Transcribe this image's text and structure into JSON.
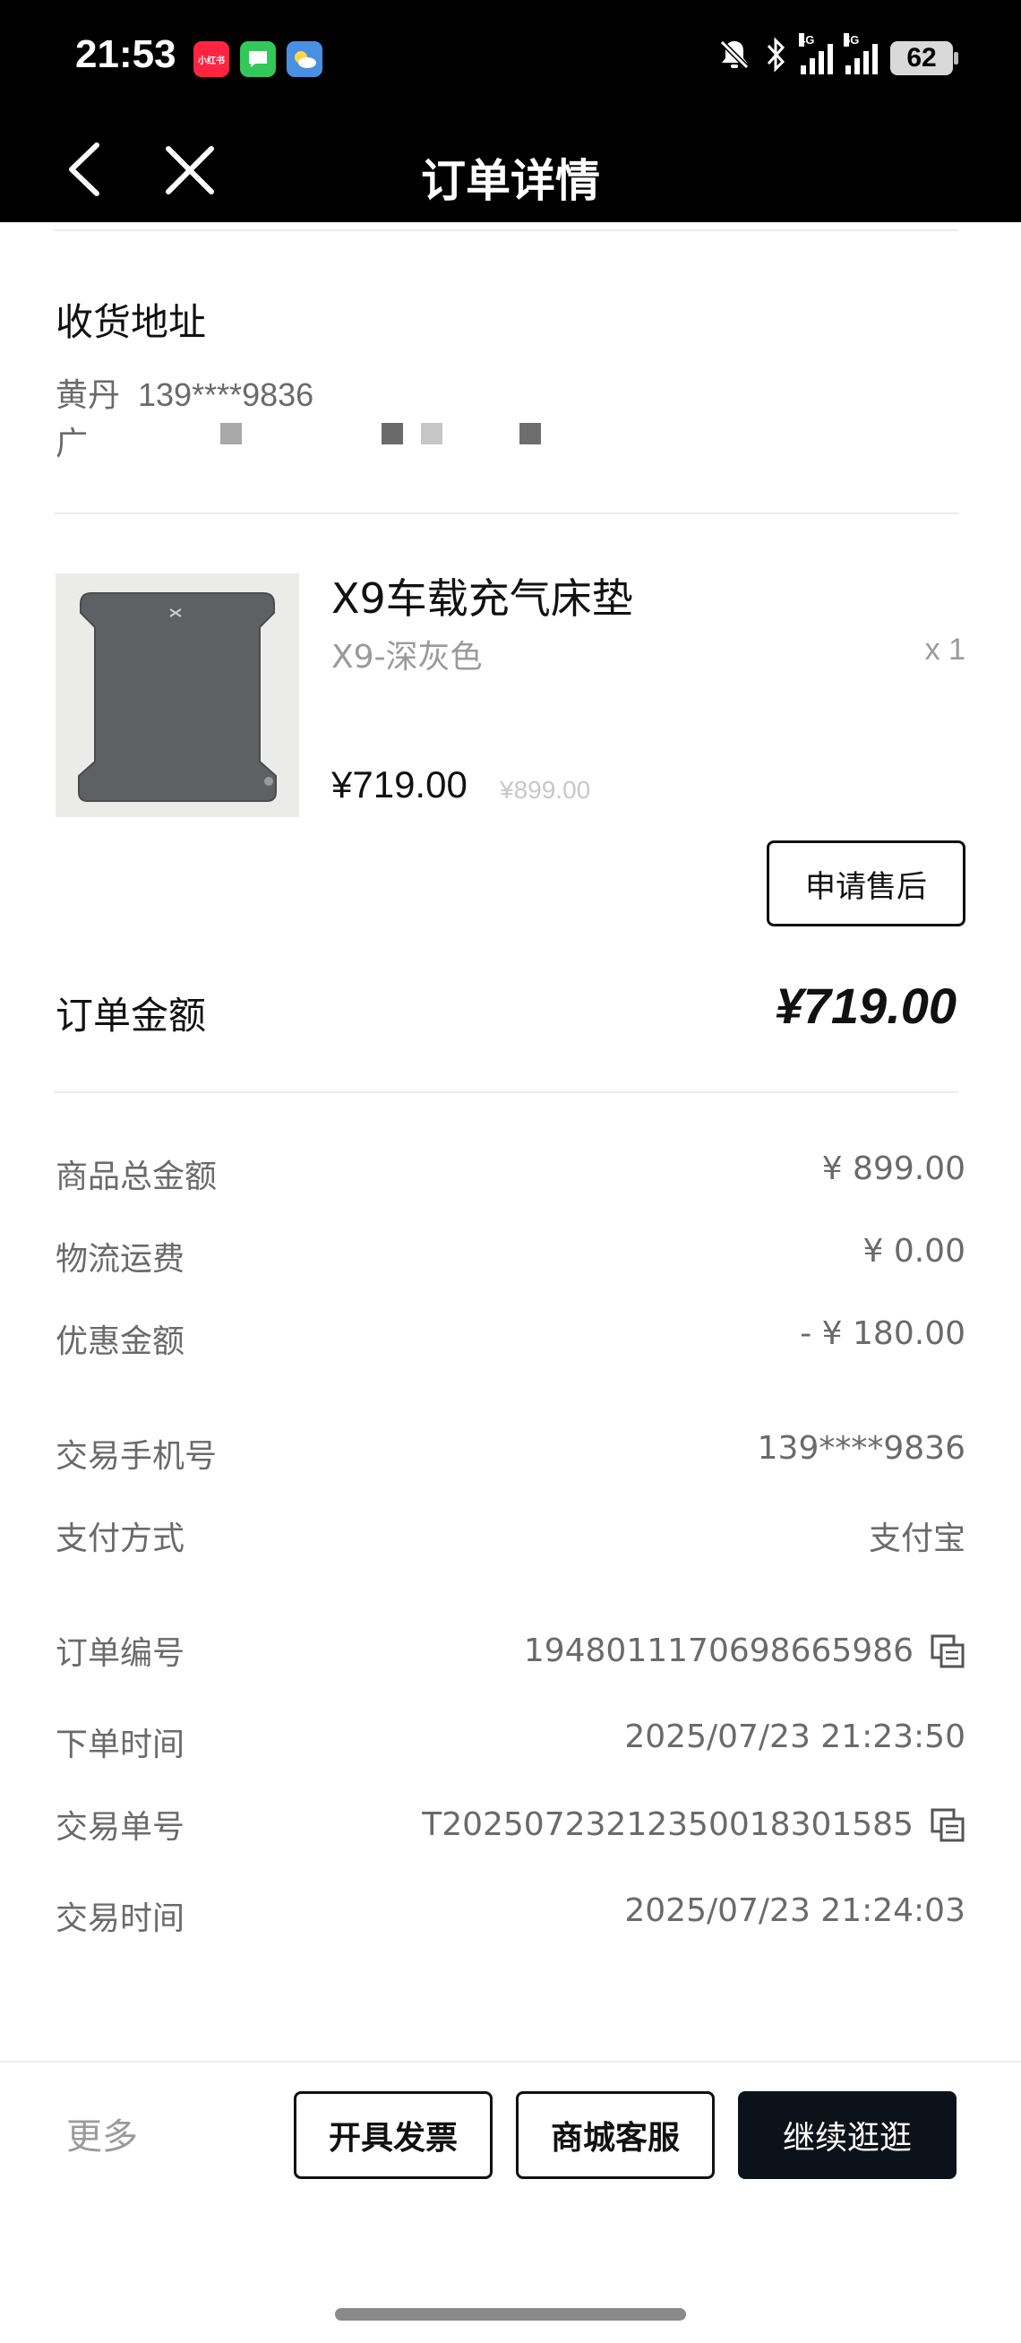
{
  "status_bar": {
    "time": "21:53",
    "apps": [
      "小红书",
      "messages-app",
      "weather-app"
    ],
    "signal_1": "4G",
    "signal_2": "5G",
    "battery": "62"
  },
  "nav": {
    "title": "订单详情"
  },
  "address": {
    "title": "收货地址",
    "name": "黄丹",
    "phone": "139****9836",
    "line": "广"
  },
  "product": {
    "name": "X9车载充气床垫",
    "variant": "X9-深灰色",
    "quantity": "x 1",
    "price": "¥719.00",
    "original_price": "¥899.00",
    "after_sales_label": "申请售后"
  },
  "order_amount": {
    "label": "订单金额",
    "value": "¥719.00"
  },
  "details": [
    {
      "key": "商品总金额",
      "value": "¥ 899.00",
      "copy": false
    },
    {
      "key": "物流运费",
      "value": "¥ 0.00",
      "copy": false
    },
    {
      "key": "优惠金额",
      "value": "- ¥ 180.00",
      "copy": false
    },
    {
      "key": "交易手机号",
      "value": "139****9836",
      "copy": false
    },
    {
      "key": "支付方式",
      "value": "支付宝",
      "copy": false
    },
    {
      "key": "订单编号",
      "value": "1948011170698665986",
      "copy": true
    },
    {
      "key": "下单时间",
      "value": "2025/07/23 21:23:50",
      "copy": false
    },
    {
      "key": "交易单号",
      "value": "T202507232123500183015​85",
      "copy": true
    },
    {
      "key": "交易时间",
      "value": "2025/07/23 21:24:03",
      "copy": false
    }
  ],
  "bottom_bar": {
    "more": "更多",
    "invoice": "开具发票",
    "service": "商城客服",
    "continue": "继续逛逛"
  },
  "colors": {
    "header_bg": "#000000",
    "primary_button_bg": "#0d111a",
    "muted_text": "#6a6a6a",
    "light_text": "#9a9a9a"
  }
}
